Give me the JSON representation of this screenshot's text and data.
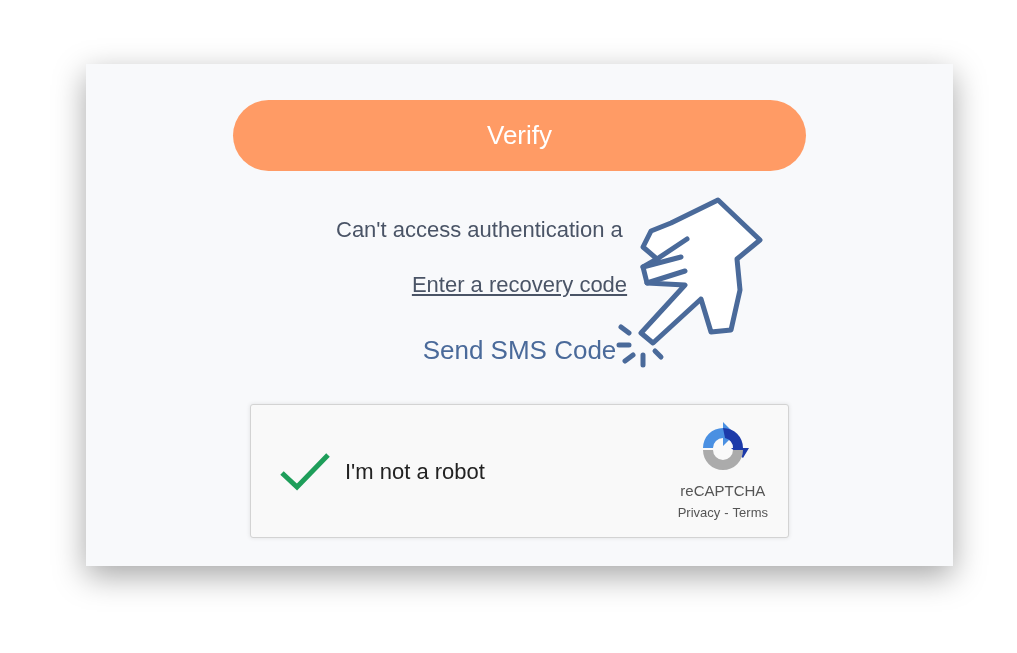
{
  "verify_button": {
    "label": "Verify"
  },
  "help_text": "Can't access authentication a",
  "recovery_link": "Enter a recovery code",
  "sms_link": "Send SMS Code",
  "recaptcha": {
    "checked": true,
    "label": "I'm not a robot",
    "brand": "reCAPTCHA",
    "privacy": "Privacy",
    "separator": "-",
    "terms": "Terms"
  }
}
